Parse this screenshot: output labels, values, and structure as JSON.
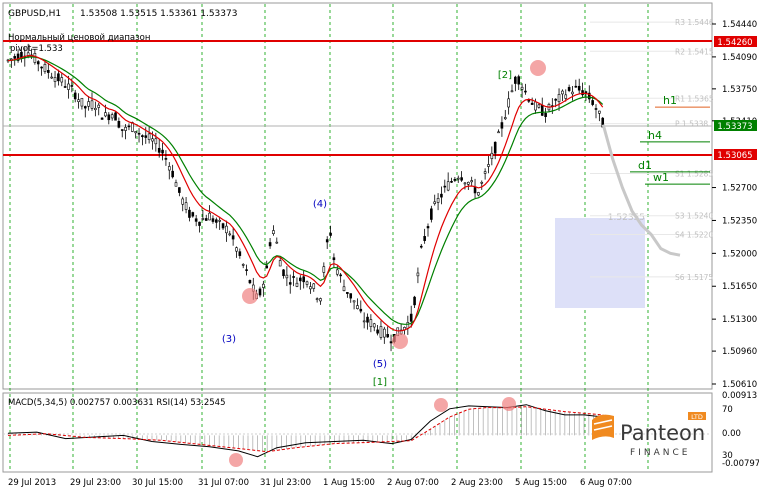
{
  "header": {
    "symbol": "GBPUSD,H1",
    "ohlc": "1.53508 1.53515 1.53361 1.53373",
    "range_label": "Нормальный ценовой диапазон",
    "pivot_label": "pivot=1.533"
  },
  "colors": {
    "background": "#ffffff",
    "grid": "#00a000",
    "candle": "#000000",
    "ma_fast": "#e00000",
    "ma_slow": "#008000",
    "resistance": "#e00000",
    "current_price": "#008000",
    "box_fill": "#dde0f8",
    "forecast": "#c8c8c8",
    "marker": "#f08080"
  },
  "chart_data": [
    {
      "type": "candlestick",
      "symbol": "GBPUSD",
      "timeframe": "H1",
      "ylim": [
        1.5061,
        1.5454
      ],
      "y_ticks": [
        "1.54440",
        "1.54090",
        "1.53750",
        "1.53410",
        "1.52700",
        "1.52350",
        "1.52000",
        "1.51650",
        "1.51300",
        "1.50960",
        "1.50610"
      ],
      "x_ticks": [
        "29 Jul 2013",
        "29 Jul 23:00",
        "30 Jul 15:00",
        "31 Jul 07:00",
        "31 Jul 23:00",
        "1 Aug 15:00",
        "2 Aug 07:00",
        "2 Aug 23:00",
        "5 Aug 15:00",
        "6 Aug 07:00"
      ],
      "close_path": [
        [
          0,
          1.5405
        ],
        [
          2,
          1.5415
        ],
        [
          4,
          1.5395
        ],
        [
          6,
          1.538
        ],
        [
          7,
          1.537
        ],
        [
          8,
          1.5355
        ],
        [
          9,
          1.536
        ],
        [
          10,
          1.5345
        ],
        [
          11,
          1.535
        ],
        [
          12,
          1.533
        ],
        [
          13,
          1.5335
        ],
        [
          14,
          1.5325
        ],
        [
          15,
          1.532
        ],
        [
          16,
          1.531
        ],
        [
          17,
          1.529
        ],
        [
          18,
          1.526
        ],
        [
          19,
          1.524
        ],
        [
          20,
          1.5235
        ],
        [
          21,
          1.524
        ],
        [
          22,
          1.523
        ],
        [
          23,
          1.5225
        ],
        [
          24,
          1.52
        ],
        [
          25,
          1.5175
        ],
        [
          26,
          1.515
        ],
        [
          26.5,
          1.5165
        ],
        [
          27,
          1.5185
        ],
        [
          27.5,
          1.523
        ],
        [
          28,
          1.521
        ],
        [
          28.5,
          1.5185
        ],
        [
          29,
          1.5175
        ],
        [
          30,
          1.517
        ],
        [
          31,
          1.5175
        ],
        [
          32,
          1.516
        ],
        [
          32.5,
          1.515
        ],
        [
          33,
          1.519
        ],
        [
          33.5,
          1.523
        ],
        [
          34,
          1.519
        ],
        [
          35,
          1.5165
        ],
        [
          36,
          1.515
        ],
        [
          37,
          1.513
        ],
        [
          38,
          1.5125
        ],
        [
          39,
          1.5115
        ],
        [
          40,
          1.511
        ],
        [
          41,
          1.5118
        ],
        [
          42,
          1.513
        ],
        [
          42.5,
          1.516
        ],
        [
          43,
          1.52
        ],
        [
          44,
          1.524
        ],
        [
          45,
          1.526
        ],
        [
          46,
          1.5275
        ],
        [
          47,
          1.5285
        ],
        [
          48,
          1.5275
        ],
        [
          49,
          1.5265
        ],
        [
          50,
          1.529
        ],
        [
          51,
          1.532
        ],
        [
          52,
          1.5355
        ],
        [
          53,
          1.539
        ],
        [
          54,
          1.537
        ],
        [
          55,
          1.5355
        ],
        [
          56,
          1.535
        ],
        [
          57,
          1.536
        ],
        [
          58,
          1.537
        ],
        [
          59,
          1.5375
        ],
        [
          60,
          1.5372
        ],
        [
          61,
          1.536
        ],
        [
          62,
          1.5337
        ]
      ],
      "forecast_path": [
        [
          62,
          1.5337
        ],
        [
          63,
          1.53
        ],
        [
          64,
          1.527
        ],
        [
          65,
          1.5245
        ],
        [
          66,
          1.523
        ],
        [
          67,
          1.522
        ],
        [
          68,
          1.5205
        ],
        [
          69,
          1.52
        ],
        [
          70,
          1.5198
        ]
      ],
      "levels": [
        {
          "price": 1.5426,
          "label": "1.54260",
          "kind": "resistance"
        },
        {
          "price": 1.53065,
          "label": "1.53065",
          "kind": "resistance"
        },
        {
          "price": 1.53373,
          "label": "1.53373",
          "kind": "current"
        }
      ],
      "pivot_levels": [
        {
          "name": "h1",
          "price": 1.5362
        },
        {
          "name": "h4",
          "price": 1.5325
        },
        {
          "name": "d1",
          "price": 1.5293
        },
        {
          "name": "w1",
          "price": 1.528
        }
      ],
      "faded_labels": [
        "R3 1.5446",
        "R2 1.5415",
        "R1 1.5365",
        "P 1.5338",
        "S1 1.5285",
        "S3 1.5240",
        "S4 1.5220",
        "S6 1.5175"
      ],
      "faded_box_label": "1.52355",
      "wave_labels": [
        "(3)",
        "(4)",
        "(5)",
        "[1]",
        "[2]"
      ]
    },
    {
      "type": "line",
      "title": "MACD(5,34,5) 0.002757 0.003631 RSI(14) 53.2545",
      "y_ticks": [
        "0.00913",
        "70",
        "0.00",
        "30",
        "-0.00797"
      ],
      "ylim": [
        -0.00797,
        0.00913
      ],
      "macd_line": [
        [
          0,
          0.0005
        ],
        [
          3,
          0.0008
        ],
        [
          6,
          -0.0008
        ],
        [
          9,
          -0.0004
        ],
        [
          12,
          0.0
        ],
        [
          15,
          -0.0015
        ],
        [
          18,
          -0.0022
        ],
        [
          21,
          -0.0028
        ],
        [
          24,
          -0.0038
        ],
        [
          26,
          -0.0052
        ],
        [
          28,
          -0.003
        ],
        [
          31,
          -0.0018
        ],
        [
          34,
          -0.0015
        ],
        [
          37,
          -0.0012
        ],
        [
          40,
          -0.002
        ],
        [
          42,
          -0.001
        ],
        [
          44,
          0.0035
        ],
        [
          46,
          0.0065
        ],
        [
          48,
          0.0072
        ],
        [
          50,
          0.007
        ],
        [
          52,
          0.0068
        ],
        [
          54,
          0.0075
        ],
        [
          56,
          0.006
        ],
        [
          58,
          0.005
        ],
        [
          60,
          0.005
        ],
        [
          62,
          0.0045
        ]
      ],
      "signal_line": [
        [
          0,
          0.0
        ],
        [
          4,
          0.0004
        ],
        [
          8,
          -0.0005
        ],
        [
          12,
          -0.0008
        ],
        [
          16,
          -0.0012
        ],
        [
          20,
          -0.0022
        ],
        [
          24,
          -0.0032
        ],
        [
          27,
          -0.004
        ],
        [
          30,
          -0.003
        ],
        [
          34,
          -0.002
        ],
        [
          38,
          -0.0017
        ],
        [
          42,
          -0.0013
        ],
        [
          44,
          0.0015
        ],
        [
          46,
          0.0045
        ],
        [
          48,
          0.0064
        ],
        [
          50,
          0.0068
        ],
        [
          52,
          0.0067
        ],
        [
          54,
          0.007
        ],
        [
          56,
          0.0064
        ],
        [
          58,
          0.0058
        ],
        [
          60,
          0.0054
        ],
        [
          62,
          0.005
        ]
      ]
    }
  ],
  "brand": {
    "name": "Panteon",
    "tagline": "FINANCE",
    "badge": "LTD"
  }
}
